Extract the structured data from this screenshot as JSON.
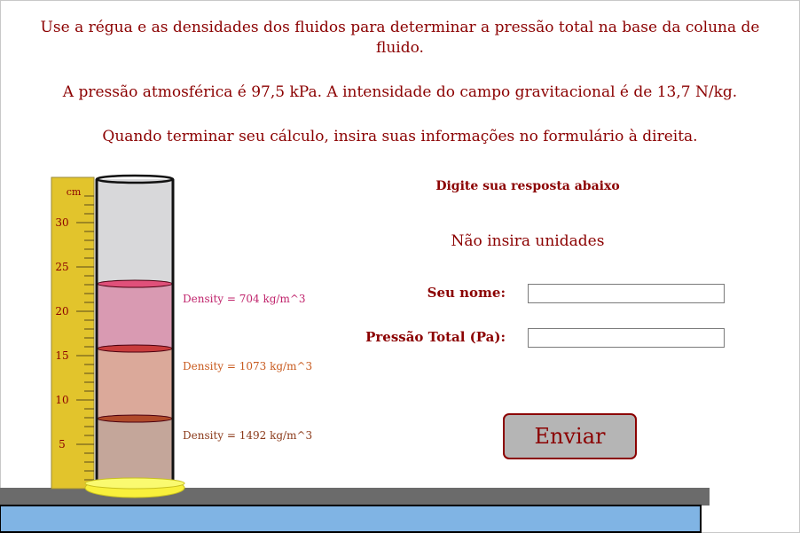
{
  "instructions": {
    "line1": "Use a régua e as densidades dos fluidos para determinar a pressão total na base da coluna de fluido.",
    "line2": "A pressão atmosférica é 97,5 kPa. A intensidade do campo gravitacional é de 13,7 N/kg.",
    "line3": "Quando terminar seu cálculo, insira suas informações no formulário à direita."
  },
  "form": {
    "heading": "Digite sua resposta abaixo",
    "subheading": "Não insira unidades",
    "name_label": "Seu nome:",
    "name_value": "",
    "pressure_label": "Pressão Total (Pa):",
    "pressure_value": "",
    "submit_label": "Enviar"
  },
  "ruler": {
    "unit": "cm",
    "tick_labels": [
      "30",
      "25",
      "20",
      "15",
      "10",
      "5"
    ]
  },
  "fluids": [
    {
      "density_label": "Density = 704 kg/m^3",
      "color": "#d99ab2",
      "surface_color": "#e0507a"
    },
    {
      "density_label": "Density = 1073 kg/m^3",
      "color": "#dba99a",
      "surface_color": "#c83c3c"
    },
    {
      "density_label": "Density = 1492 kg/m^3",
      "color": "#c4a69a",
      "surface_color": "#b04a2a"
    }
  ],
  "colors": {
    "text": "#8b0000",
    "ruler": "#e2c42c",
    "table_top": "#6b6b6b",
    "table_front": "#80b4e4",
    "cylinder_base": "#f8f03c",
    "cylinder_empty": "#d8d8da"
  }
}
